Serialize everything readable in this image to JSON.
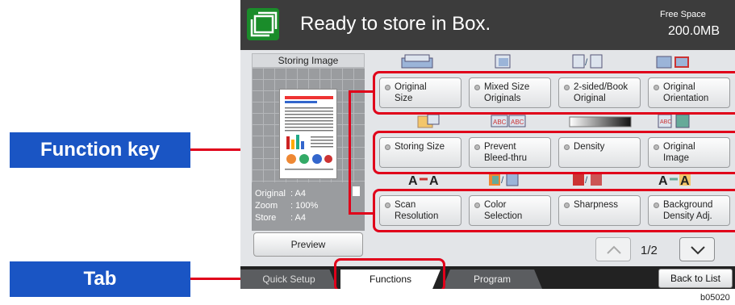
{
  "header": {
    "status": "Ready to store in Box.",
    "free_space_label": "Free Space",
    "free_space_value": "200.0MB"
  },
  "left_panel": {
    "title": "Storing Image",
    "original_label": "Original",
    "original_value": ": A4",
    "zoom_label": "Zoom",
    "zoom_value": ": 100%",
    "store_label": "Store",
    "store_value": ": A4",
    "preview_button": "Preview"
  },
  "functions": {
    "row1": [
      {
        "label": "Original\nSize"
      },
      {
        "label": "Mixed Size\nOriginals"
      },
      {
        "label": "2-sided/Book\nOriginal"
      },
      {
        "label": "Original\nOrientation"
      }
    ],
    "row2": [
      {
        "label": "Storing Size"
      },
      {
        "label": "Prevent\nBleed-thru"
      },
      {
        "label": "Density"
      },
      {
        "label": "Original\nImage"
      }
    ],
    "row3": [
      {
        "label": "Scan\nResolution"
      },
      {
        "label": "Color\nSelection"
      },
      {
        "label": "Sharpness"
      },
      {
        "label": "Background\nDensity Adj."
      }
    ]
  },
  "pager": {
    "current": "1/2"
  },
  "tabs": {
    "quick_setup": "Quick Setup",
    "functions": "Functions",
    "program": "Program",
    "back_to_list": "Back to List"
  },
  "callouts": {
    "function_key": "Function key",
    "tab": "Tab"
  },
  "image_code": "b05020",
  "colors": {
    "callout_bg": "#1a55c4",
    "highlight": "#e0001a",
    "box_icon": "#1a8c2a"
  }
}
